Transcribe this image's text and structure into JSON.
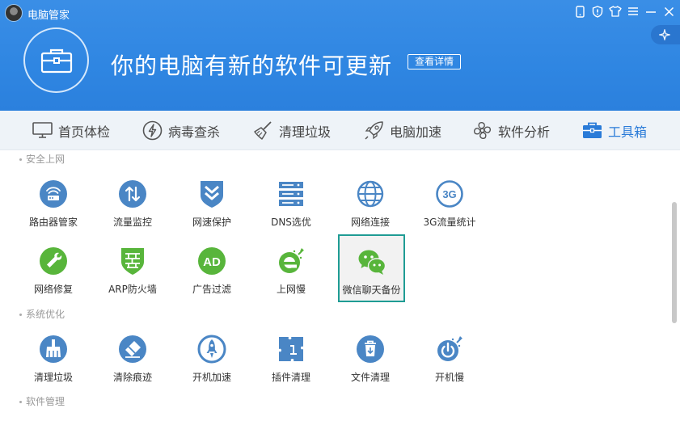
{
  "app": {
    "title": "电脑管家"
  },
  "window_buttons": [
    {
      "name": "phone-icon"
    },
    {
      "name": "shield-icon"
    },
    {
      "name": "shirt-icon"
    },
    {
      "name": "menu-icon"
    },
    {
      "name": "minimize-icon"
    },
    {
      "name": "close-icon"
    }
  ],
  "banner": {
    "icon": "toolbox-icon",
    "message": "你的电脑有新的软件可更新",
    "details_label": "查看详情",
    "side_icon": "sparkle-icon"
  },
  "colors": {
    "header_blue": "#2f86e2",
    "active_tab": "#2a7bd8",
    "tool_blue": "#4a86c5",
    "tool_green": "#58b53b",
    "selected_border": "#1f9c94"
  },
  "tabs": [
    {
      "label": "首页体检",
      "icon": "monitor-icon",
      "active": false
    },
    {
      "label": "病毒查杀",
      "icon": "lightning-icon",
      "active": false
    },
    {
      "label": "清理垃圾",
      "icon": "broom-icon",
      "active": false
    },
    {
      "label": "电脑加速",
      "icon": "rocket-icon",
      "active": false
    },
    {
      "label": "软件分析",
      "icon": "fan-icon",
      "active": false
    },
    {
      "label": "工具箱",
      "icon": "toolbox-icon",
      "active": true
    }
  ],
  "sections": [
    {
      "title": "安全上网",
      "tools": [
        {
          "label": "路由器管家",
          "icon": "router-icon"
        },
        {
          "label": "流量监控",
          "icon": "traffic-arrows-icon"
        },
        {
          "label": "网速保护",
          "icon": "chevron-shield-icon"
        },
        {
          "label": "DNS选优",
          "icon": "server-icon"
        },
        {
          "label": "网络连接",
          "icon": "globe-icon"
        },
        {
          "label": "3G流量统计",
          "icon": "3g-icon",
          "icon_text": "3G"
        },
        {
          "label": "网络修复",
          "icon": "wrench-icon"
        },
        {
          "label": "ARP防火墙",
          "icon": "firewall-icon"
        },
        {
          "label": "广告过滤",
          "icon": "ad-block-icon",
          "icon_text": "AD"
        },
        {
          "label": "上网慢",
          "icon": "ie-speed-icon"
        },
        {
          "label": "微信聊天备份",
          "icon": "wechat-icon",
          "selected": true
        }
      ]
    },
    {
      "title": "系统优化",
      "tools": [
        {
          "label": "清理垃圾",
          "icon": "brush-clean-icon"
        },
        {
          "label": "清除痕迹",
          "icon": "eraser-icon"
        },
        {
          "label": "开机加速",
          "icon": "boot-rocket-icon"
        },
        {
          "label": "插件清理",
          "icon": "puzzle-icon"
        },
        {
          "label": "文件清理",
          "icon": "trash-icon"
        },
        {
          "label": "开机慢",
          "icon": "power-slow-icon"
        }
      ]
    },
    {
      "title": "软件管理",
      "tools": []
    }
  ]
}
